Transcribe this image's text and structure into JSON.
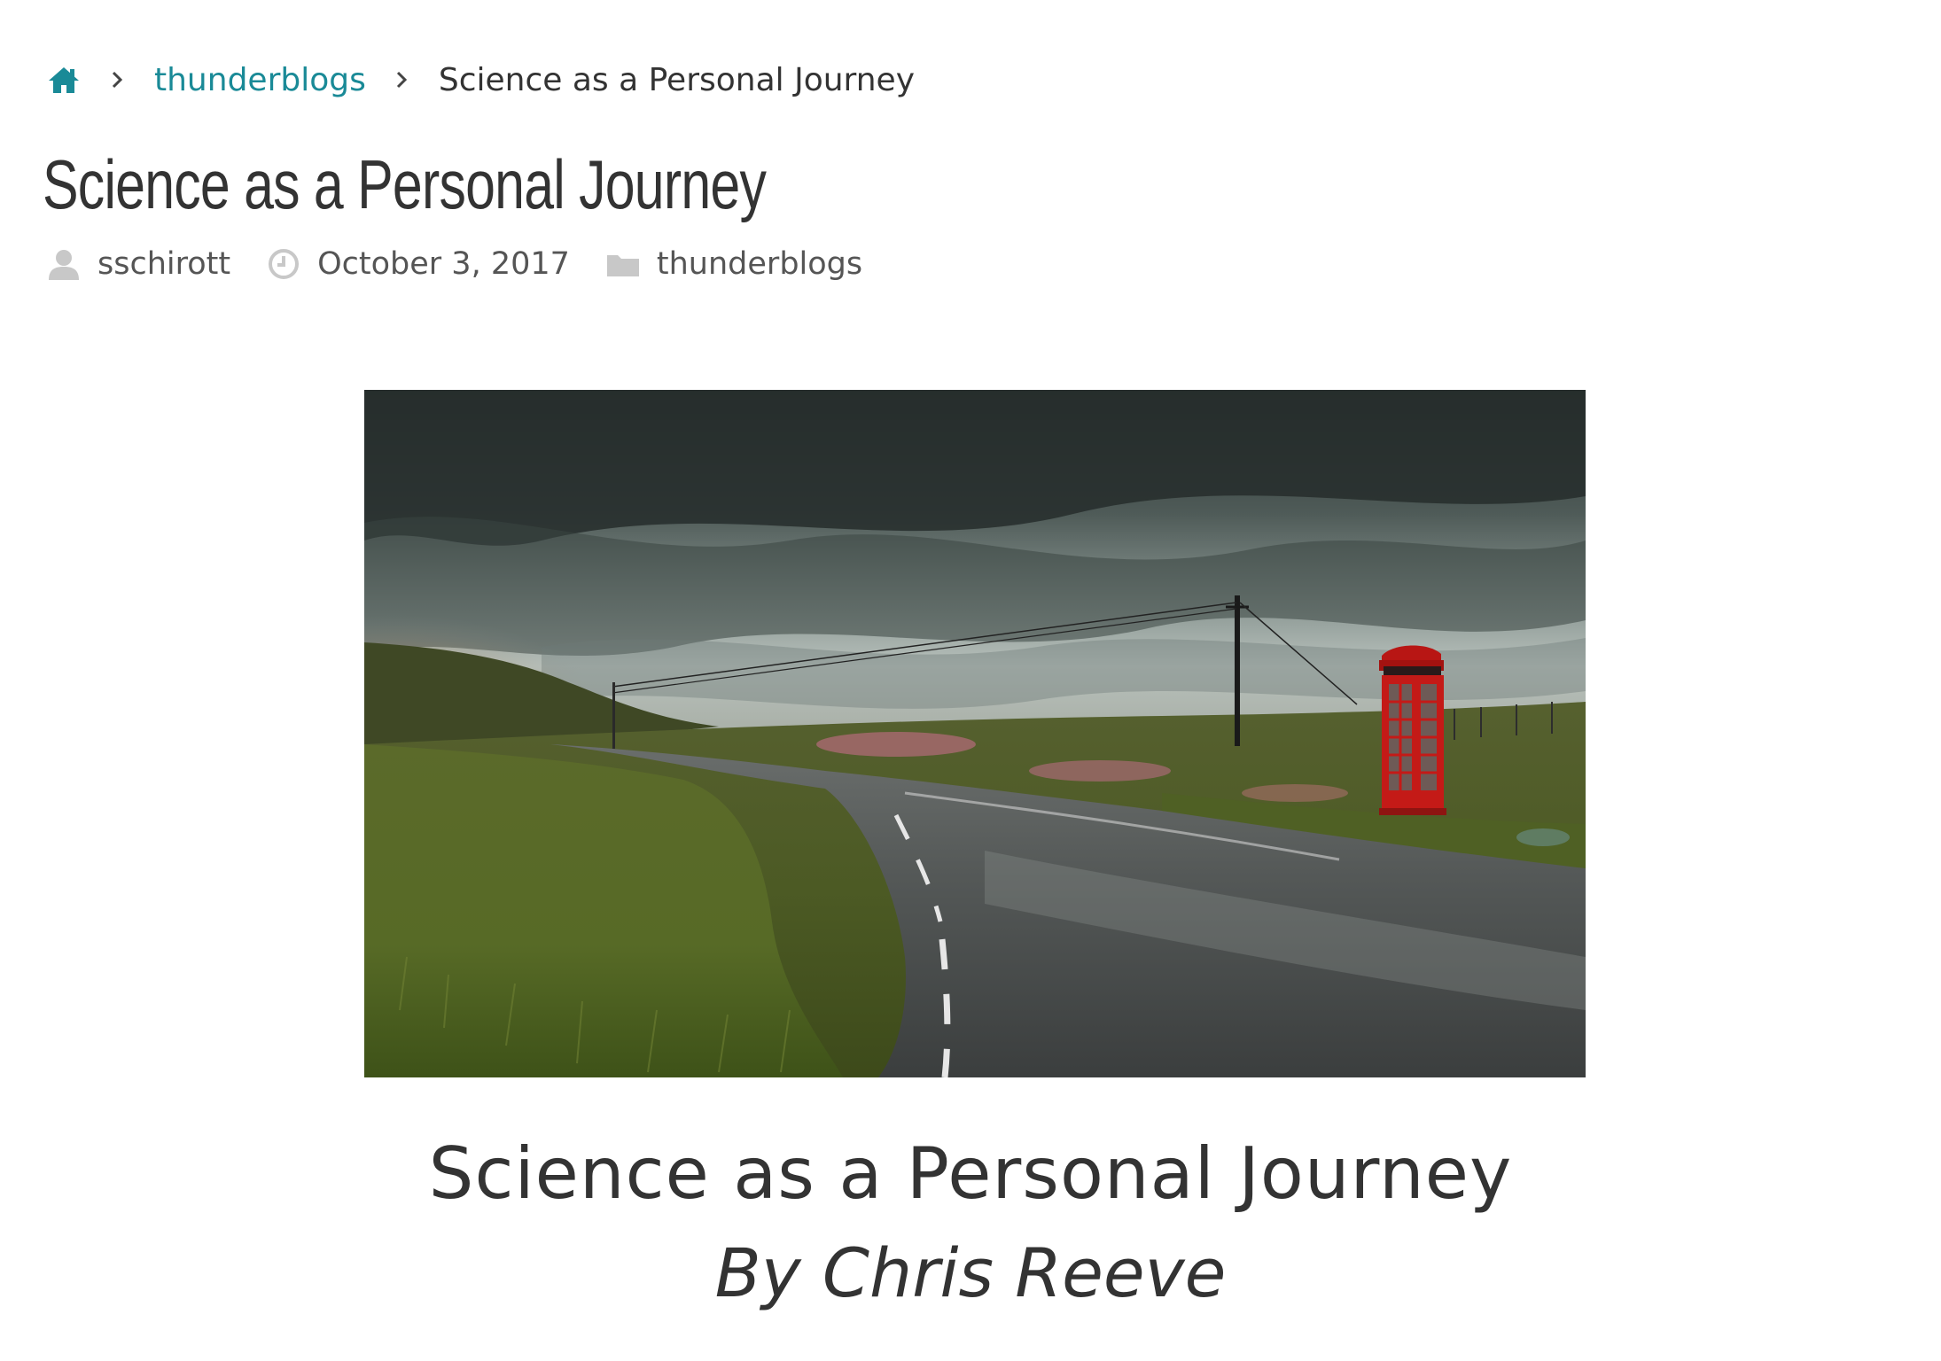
{
  "breadcrumb": {
    "home_icon": "home-icon",
    "separator_icon": "chevron-right-icon",
    "category": "thunderblogs",
    "current": "Science as a Personal Journey"
  },
  "post": {
    "title": "Science as a Personal Journey",
    "author": "sschirott",
    "date": "October 3, 2017",
    "category": "thunderblogs"
  },
  "icons": {
    "author": "user-icon",
    "date": "clock-icon",
    "category": "folder-icon"
  },
  "featured_image": {
    "subject": "red telephone box beside a wet country road under stormy sky"
  },
  "caption": {
    "title": "Science as a Personal Journey",
    "byline": "By Chris Reeve"
  },
  "colors": {
    "link": "#1a8a97",
    "text": "#333333",
    "meta_icon": "#c8c8c8"
  }
}
